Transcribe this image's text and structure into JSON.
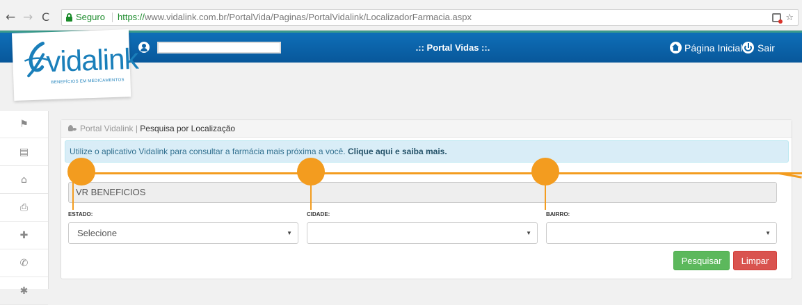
{
  "browser": {
    "secure_label": "Seguro",
    "url_scheme": "https://",
    "url_rest": "www.vidalink.com.br/PortalVida/Paginas/PortalVidalink/LocalizadorFarmacia.aspx",
    "back_icon": "arrow-left-icon",
    "forward_icon": "arrow-right-icon",
    "reload_icon": "reload-icon",
    "bookmark_icon": "star-icon"
  },
  "header": {
    "portal_title": ".:: Portal Vidas ::.",
    "home_label": "Página Inicial",
    "logout_label": "Sair",
    "accent_color": "#3a9b8c",
    "bar_color": "#0c64a8"
  },
  "logo": {
    "name": "vidalink",
    "tagline": "BENEFÍCIOS EM MEDICAMENTOS"
  },
  "sidebar": {
    "items": [
      {
        "icon": "flag-icon",
        "glyph": "⚑"
      },
      {
        "icon": "document-icon",
        "glyph": "▤"
      },
      {
        "icon": "home-icon",
        "glyph": "⌂"
      },
      {
        "icon": "printer-icon",
        "glyph": "⎙"
      },
      {
        "icon": "pharmacy-icon",
        "glyph": "✚"
      },
      {
        "icon": "phone-icon",
        "glyph": "✆"
      },
      {
        "icon": "settings-icon",
        "glyph": "✱"
      }
    ]
  },
  "panel": {
    "breadcrumb_parent": "Portal Vidalink |",
    "breadcrumb_current": "Pesquisa por Localização",
    "info_text": "Utilize o aplicativo Vidalink para consultar a farmácia mais próxima a você.",
    "info_link": "Clique aqui e saiba mais.",
    "company_value": "VR BENEFICIOS",
    "fields": {
      "estado": {
        "label": "ESTADO:",
        "value": "Selecione"
      },
      "cidade": {
        "label": "CIDADE:",
        "value": ""
      },
      "bairro": {
        "label": "BAIRRO:",
        "value": ""
      }
    },
    "search_button": "Pesquisar",
    "clear_button": "Limpar",
    "colors": {
      "success": "#5cb85c",
      "danger": "#d9534f",
      "info_bg": "#d9edf7",
      "annotation": "#f39c1f"
    }
  }
}
